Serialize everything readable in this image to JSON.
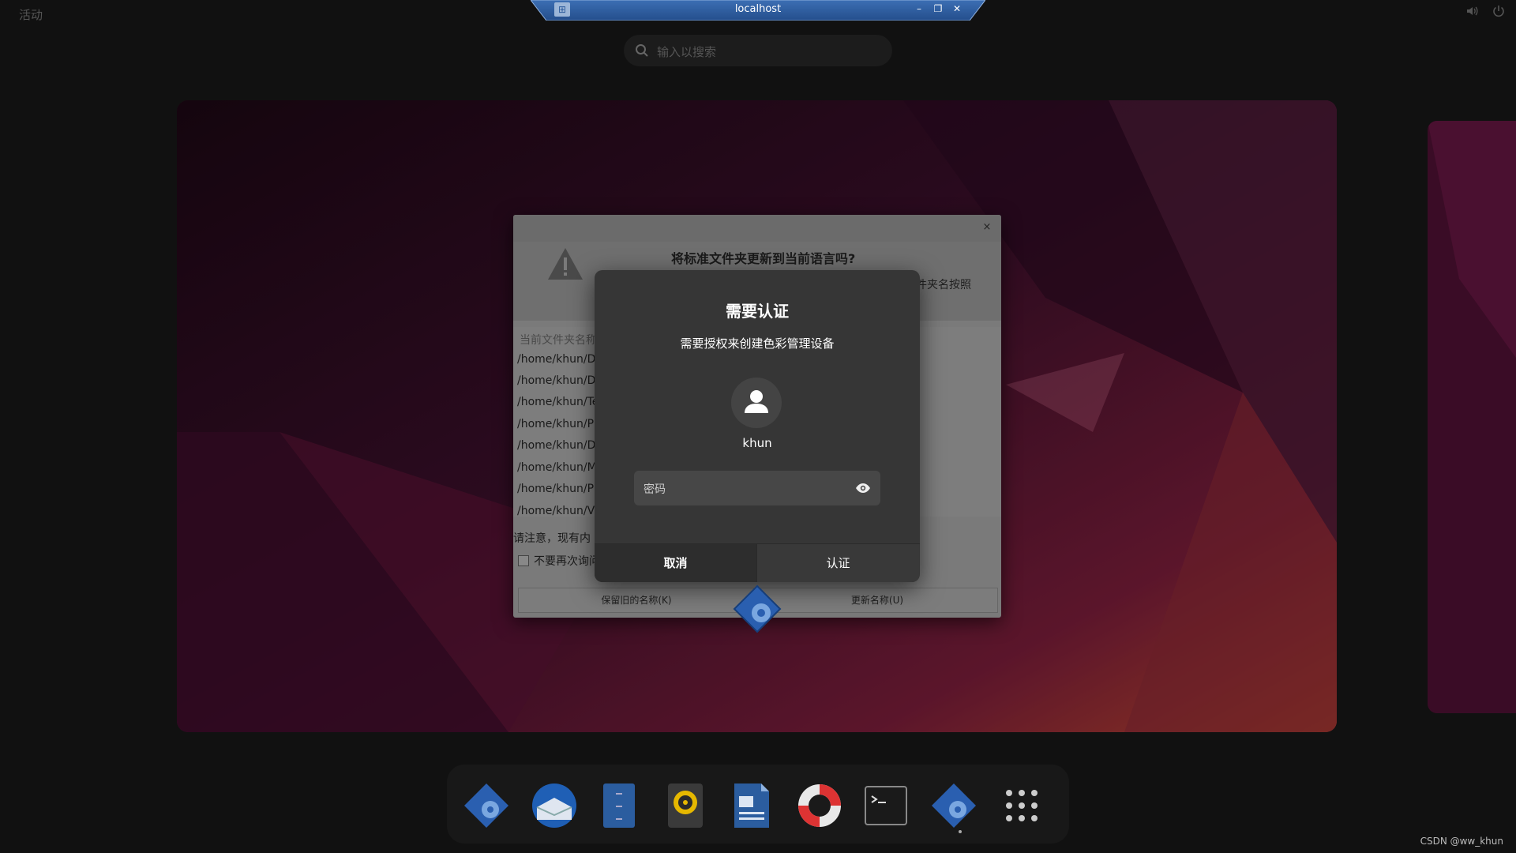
{
  "topbar": {
    "activities": "活动",
    "volume_icon": "volume-icon",
    "power_icon": "power-icon"
  },
  "rdp": {
    "title": "localhost",
    "pin_icon": "pin-icon",
    "minimize_icon": "minimize-icon",
    "restore_icon": "restore-icon",
    "close_icon": "close-icon"
  },
  "search": {
    "placeholder": "输入以搜索"
  },
  "xdg_dialog": {
    "title": "将标准文件夹更新到当前语言吗?",
    "subtitle": "件夹名按照",
    "list_header": "当前文件夹名称",
    "rows": [
      "/home/khun/D",
      "/home/khun/D",
      "/home/khun/Te",
      "/home/khun/P",
      "/home/khun/D",
      "/home/khun/M",
      "/home/khun/P",
      "/home/khun/Vi"
    ],
    "note": "请注意，现有内",
    "checkbox_label": "不要再次询问",
    "keep_button": "保留旧的名称(K)",
    "update_button": "更新名称(U)",
    "close_label": "×"
  },
  "auth_dialog": {
    "title": "需要认证",
    "message": "需要授权来创建色彩管理设备",
    "username": "khun",
    "password_placeholder": "密码",
    "cancel_label": "取消",
    "authenticate_label": "认证"
  },
  "dock": {
    "items": [
      "software-properties-icon",
      "thunderbird-icon",
      "files-icon",
      "rhythmbox-icon",
      "writer-icon",
      "help-icon",
      "terminal-icon",
      "software-properties-running-icon",
      "app-grid-icon"
    ]
  },
  "watermark": "CSDN @ww_khun",
  "colors": {
    "rdp_bar": "#2f5fa2",
    "auth_bg": "#363636",
    "wallpaper_accent": "#b02a4a"
  }
}
